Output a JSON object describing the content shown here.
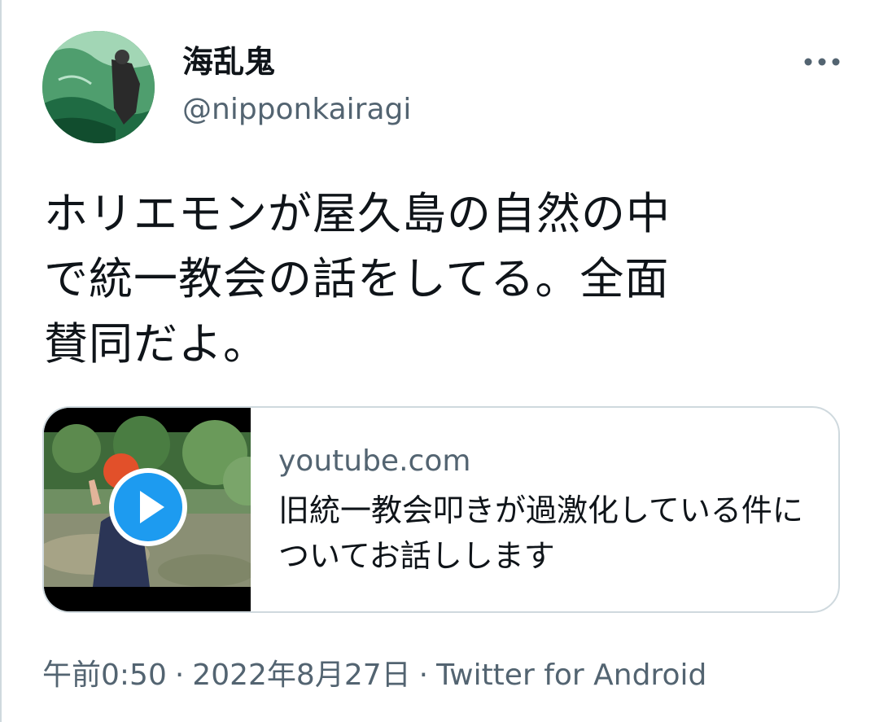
{
  "author": {
    "display_name": "海乱鬼",
    "handle": "@nipponkairagi",
    "avatar_icon": "profile-avatar"
  },
  "more_icon": "more-horizontal-icon",
  "tweet": {
    "text": "ホリエモンが屋久島の自然の中\nで統一教会の話をしてる。全面\n賛同だよ。"
  },
  "card": {
    "domain": "youtube.com",
    "title": "旧統一教会叩きが過激化している件についてお話しします",
    "play_icon": "play-icon",
    "play_color": "#1d9bf0"
  },
  "meta": {
    "time": "午前0:50",
    "separator": "·",
    "date": "2022年8月27日",
    "source": "Twitter for Android"
  },
  "colors": {
    "secondary_text": "#536471",
    "border": "#cfd9de",
    "primary_text": "#0f1419"
  }
}
